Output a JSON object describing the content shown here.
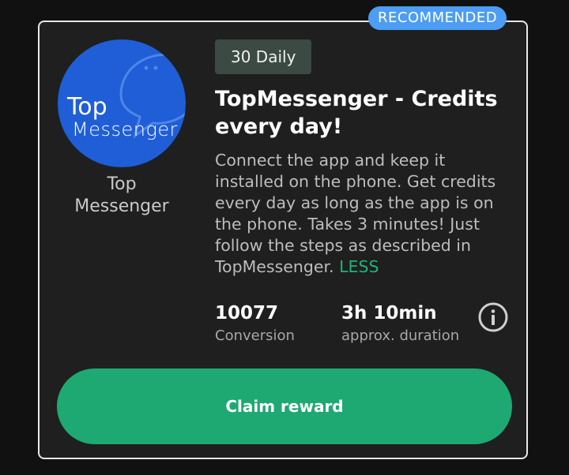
{
  "badge": "RECOMMENDED",
  "app": {
    "logo_line1": "Top",
    "logo_line2": "Messenger",
    "name": "Top\nMessenger",
    "logo_color": "#1f5ed6"
  },
  "offer": {
    "tag": "30 Daily",
    "title": "TopMessenger - Credits every day!",
    "description": "Connect the app and keep it installed on the phone. Get credits every day as long as the app is on the phone. Takes 3 minutes! Just follow the steps as described in TopMessenger.",
    "less_link": "LESS"
  },
  "stats": {
    "conversion_value": "10077",
    "conversion_label": "Conversion",
    "duration_value": "3h 10min",
    "duration_label": "approx. duration"
  },
  "info_icon": "info-icon",
  "claim_button": "Claim reward",
  "colors": {
    "accent_green": "#1ea972",
    "badge_blue": "#4c9df3",
    "tag_bg": "#3c4a44",
    "card_bg": "#1f1f1f"
  }
}
